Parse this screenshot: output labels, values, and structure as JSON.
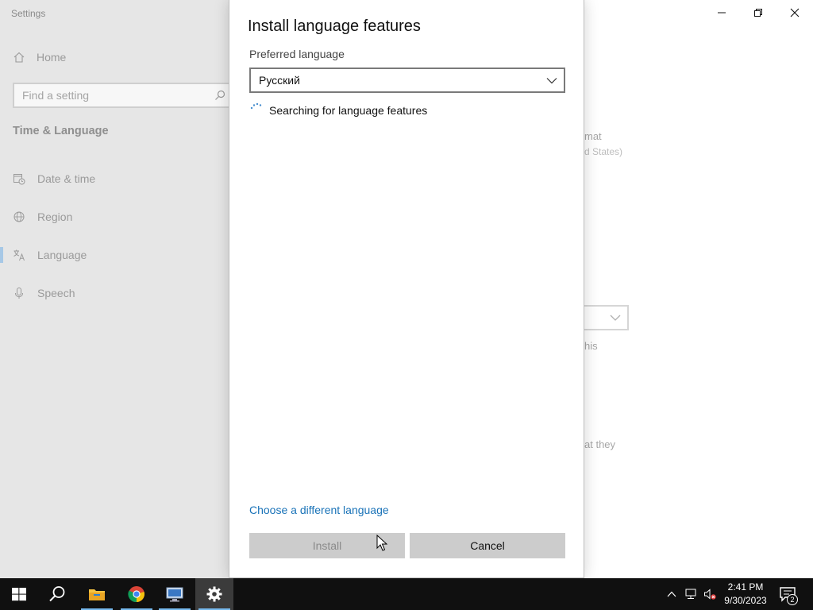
{
  "window": {
    "title": "Settings",
    "caption_buttons": [
      "minimize-icon",
      "restore-icon",
      "close-icon"
    ]
  },
  "sidebar": {
    "home_label": "Home",
    "search_placeholder": "Find a setting",
    "section_title": "Time & Language",
    "items": [
      {
        "label": "Date & time",
        "icon": "calendar-clock-icon"
      },
      {
        "label": "Region",
        "icon": "globe-icon"
      },
      {
        "label": "Language",
        "icon": "language-icon",
        "active": true
      },
      {
        "label": "Speech",
        "icon": "microphone-icon"
      }
    ]
  },
  "background_fragments": {
    "format": "mat",
    "format_sub": "d States)",
    "this": "his",
    "at_they": "at they"
  },
  "dialog": {
    "title": "Install language features",
    "preferred_label": "Preferred language",
    "selected_language": "Русский",
    "status": "Searching for language features",
    "link": "Choose a different language",
    "install_label": "Install",
    "cancel_label": "Cancel"
  },
  "taskbar": {
    "pinned": [
      "windows-start-icon",
      "search-icon",
      "file-explorer-icon",
      "chrome-icon",
      "remote-desktop-icon",
      "settings-icon"
    ],
    "tray": [
      "chevron-up-icon",
      "network-icon",
      "volume-muted-icon"
    ],
    "time": "2:41 PM",
    "date": "9/30/2023",
    "notification_count": "2"
  },
  "colors": {
    "accent": "#1a73b8",
    "active_indicator": "#a7c8e6",
    "taskbar": "#101010"
  }
}
